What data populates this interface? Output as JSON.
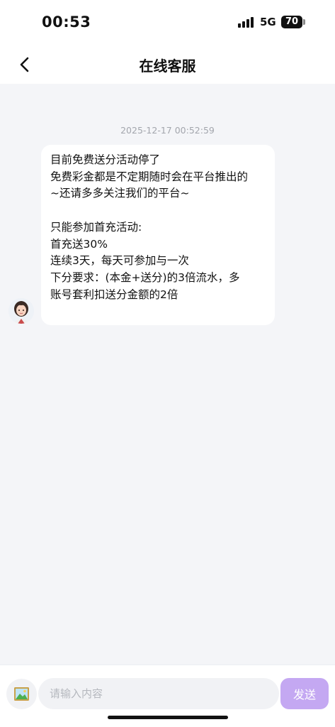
{
  "status_bar": {
    "time": "00:53",
    "network": "5G",
    "battery": "70"
  },
  "header": {
    "title": "在线客服",
    "back_icon": "chevron-left-icon"
  },
  "chat": {
    "timestamp": "2025-12-17 00:52:59",
    "message": {
      "sender_avatar": "agent-avatar",
      "lines": [
        "目前免费送分活动停了",
        "免费彩金都是不定期随时会在平台推出的",
        "~还请多多关注我们的平台~",
        "",
        "只能参加首充活动:",
        "首充送30%",
        "连续3天，每天可参加与一次",
        "下分要求：(本金+送分)的3倍流水，多",
        "账号套利扣送分金额的2倍"
      ]
    }
  },
  "input_bar": {
    "image_icon": "image-picker-icon",
    "placeholder": "请输入内容",
    "value": "",
    "send_label": "发送",
    "send_color": "#c4a8f2"
  }
}
